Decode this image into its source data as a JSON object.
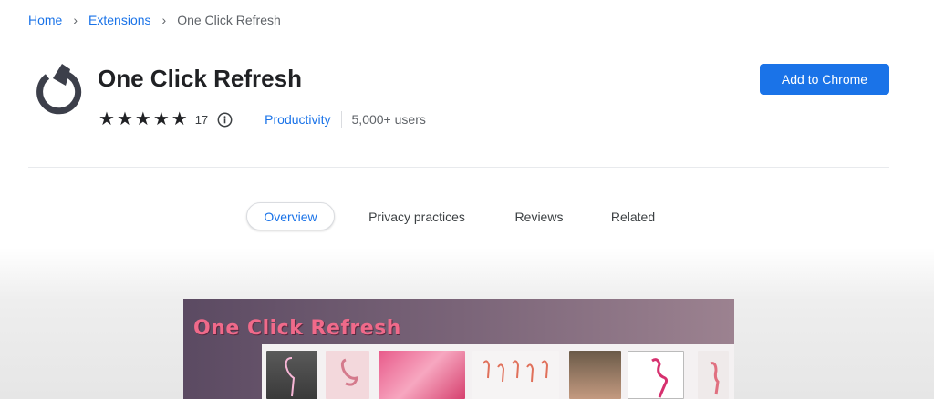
{
  "breadcrumb": {
    "home": "Home",
    "extensions": "Extensions",
    "current": "One Click Refresh"
  },
  "extension": {
    "name": "One Click Refresh",
    "rating": 5,
    "rating_count": "17",
    "category": "Productivity",
    "users": "5,000+ users"
  },
  "actions": {
    "add_button": "Add to Chrome"
  },
  "tabs": [
    {
      "label": "Overview",
      "active": true
    },
    {
      "label": "Privacy practices",
      "active": false
    },
    {
      "label": "Reviews",
      "active": false
    },
    {
      "label": "Related",
      "active": false
    }
  ],
  "gallery": {
    "screenshot_title": "One Click Refresh"
  },
  "colors": {
    "accent": "#1a73e8",
    "icon": "#3c3f4a"
  },
  "icons": {
    "ext": "refresh-icon",
    "info": "info-icon",
    "separator": "chevron-right-icon",
    "star": "star-icon"
  }
}
